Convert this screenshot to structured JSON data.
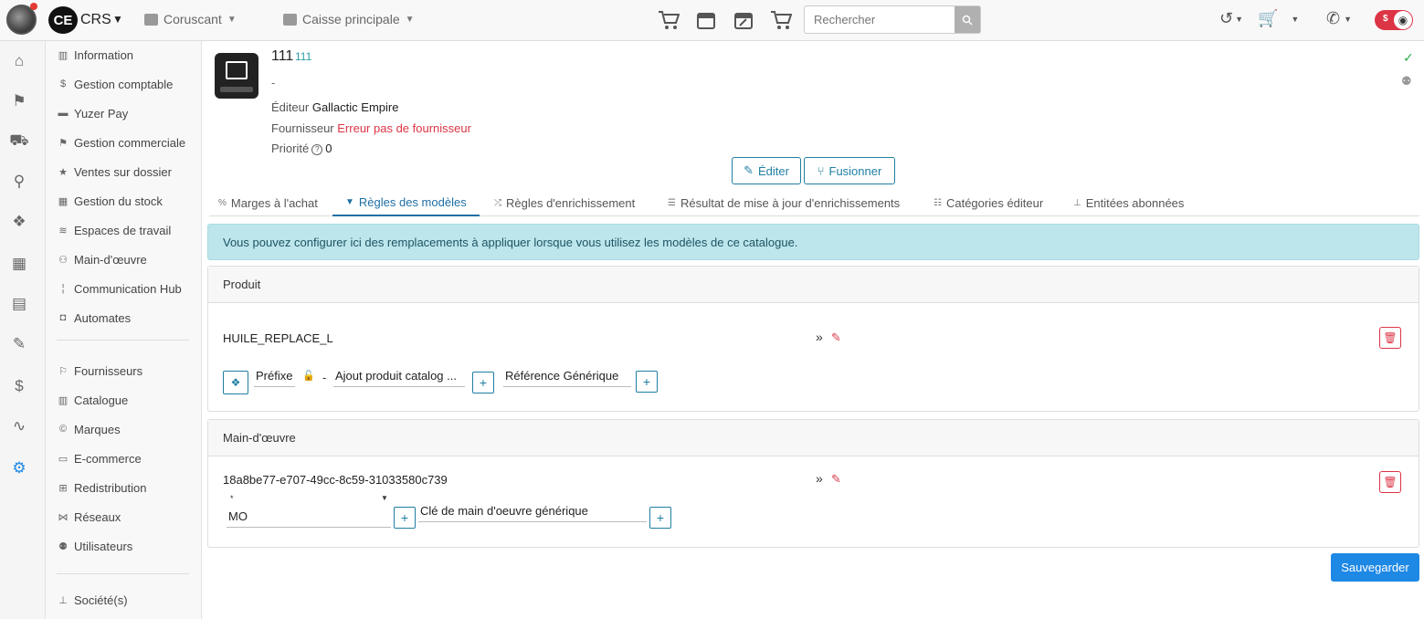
{
  "topbar": {
    "user_initials": "CE",
    "org": "CRS",
    "location": "Coruscant",
    "register": "Caisse principale",
    "search_placeholder": "Rechercher"
  },
  "sidebar": {
    "items": [
      {
        "label": "Information"
      },
      {
        "label": "Gestion comptable"
      },
      {
        "label": "Yuzer Pay"
      },
      {
        "label": "Gestion commerciale"
      },
      {
        "label": "Ventes sur dossier"
      },
      {
        "label": "Gestion du stock"
      },
      {
        "label": "Espaces de travail"
      },
      {
        "label": "Main-d'œuvre"
      },
      {
        "label": "Communication Hub"
      },
      {
        "label": "Automates"
      },
      {
        "label": "Fournisseurs"
      },
      {
        "label": "Catalogue"
      },
      {
        "label": "Marques"
      },
      {
        "label": "E-commerce"
      },
      {
        "label": "Redistribution"
      },
      {
        "label": "Réseaux"
      },
      {
        "label": "Utilisateurs"
      },
      {
        "label": "Société(s)"
      }
    ]
  },
  "catalog": {
    "title": "111",
    "code": "111",
    "description": "-",
    "editor_label": "Éditeur",
    "editor_value": "Gallactic Empire",
    "supplier_label": "Fournisseur",
    "supplier_value": "Erreur pas de fournisseur",
    "priority_label": "Priorité",
    "priority_value": "0"
  },
  "actions": {
    "edit": "Éditer",
    "merge": "Fusionner",
    "save": "Sauvegarder"
  },
  "tabs": [
    {
      "label": "Marges à l'achat"
    },
    {
      "label": "Règles des modèles"
    },
    {
      "label": "Règles d'enrichissement"
    },
    {
      "label": "Résultat de mise à jour d'enrichissements"
    },
    {
      "label": "Catégories éditeur"
    },
    {
      "label": "Entitées abonnées"
    }
  ],
  "alert": "Vous pouvez configurer ici des remplacements à appliquer lorsque vous utilisez les modèles de ce catalogue.",
  "product_card": {
    "title": "Produit",
    "rule_name": "HUILE_REPLACE_L",
    "prefix": "Préfixe",
    "separator": "-",
    "field1": "Ajout produit catalog ...",
    "field2": "Référence Générique"
  },
  "labor_card": {
    "title": "Main-d'œuvre",
    "rule_name": "18a8be77-e707-49cc-8c59-31033580c739",
    "select_small": "*",
    "select_value": "MO",
    "field2": "Clé de main d'oeuvre générique"
  }
}
